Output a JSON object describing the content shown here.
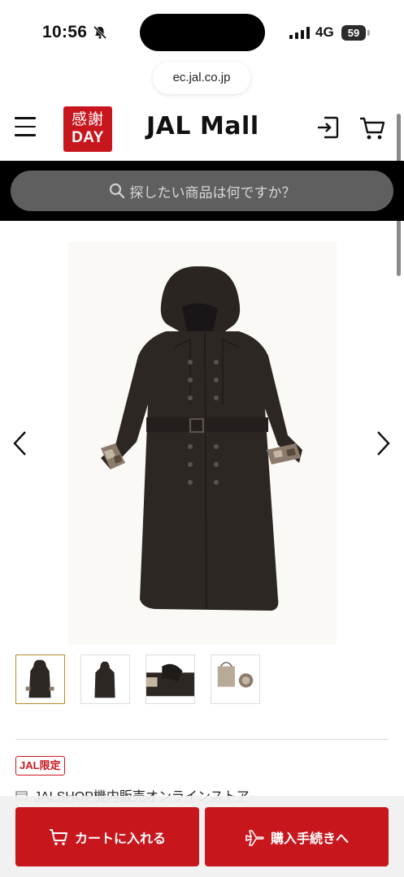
{
  "status": {
    "time": "10:56",
    "network": "4G",
    "battery": "59"
  },
  "browser": {
    "url": "ec.jal.co.jp"
  },
  "header": {
    "promo_top": "感謝",
    "promo_bottom": "DAY",
    "logo_text": "JAL Mall",
    "brand_color": "#c8161d"
  },
  "search": {
    "placeholder": "探したい商品は何ですか？"
  },
  "product": {
    "image_subject": "trench-coat-with-hood",
    "thumbnail_count": 4,
    "selected_thumbnail": 1,
    "badge": "JAL限定",
    "shop_name": "JALSHOP機内販売オンラインストア"
  },
  "actions": {
    "add_to_cart": "カートに入れる",
    "checkout": "購入手続きへ"
  }
}
